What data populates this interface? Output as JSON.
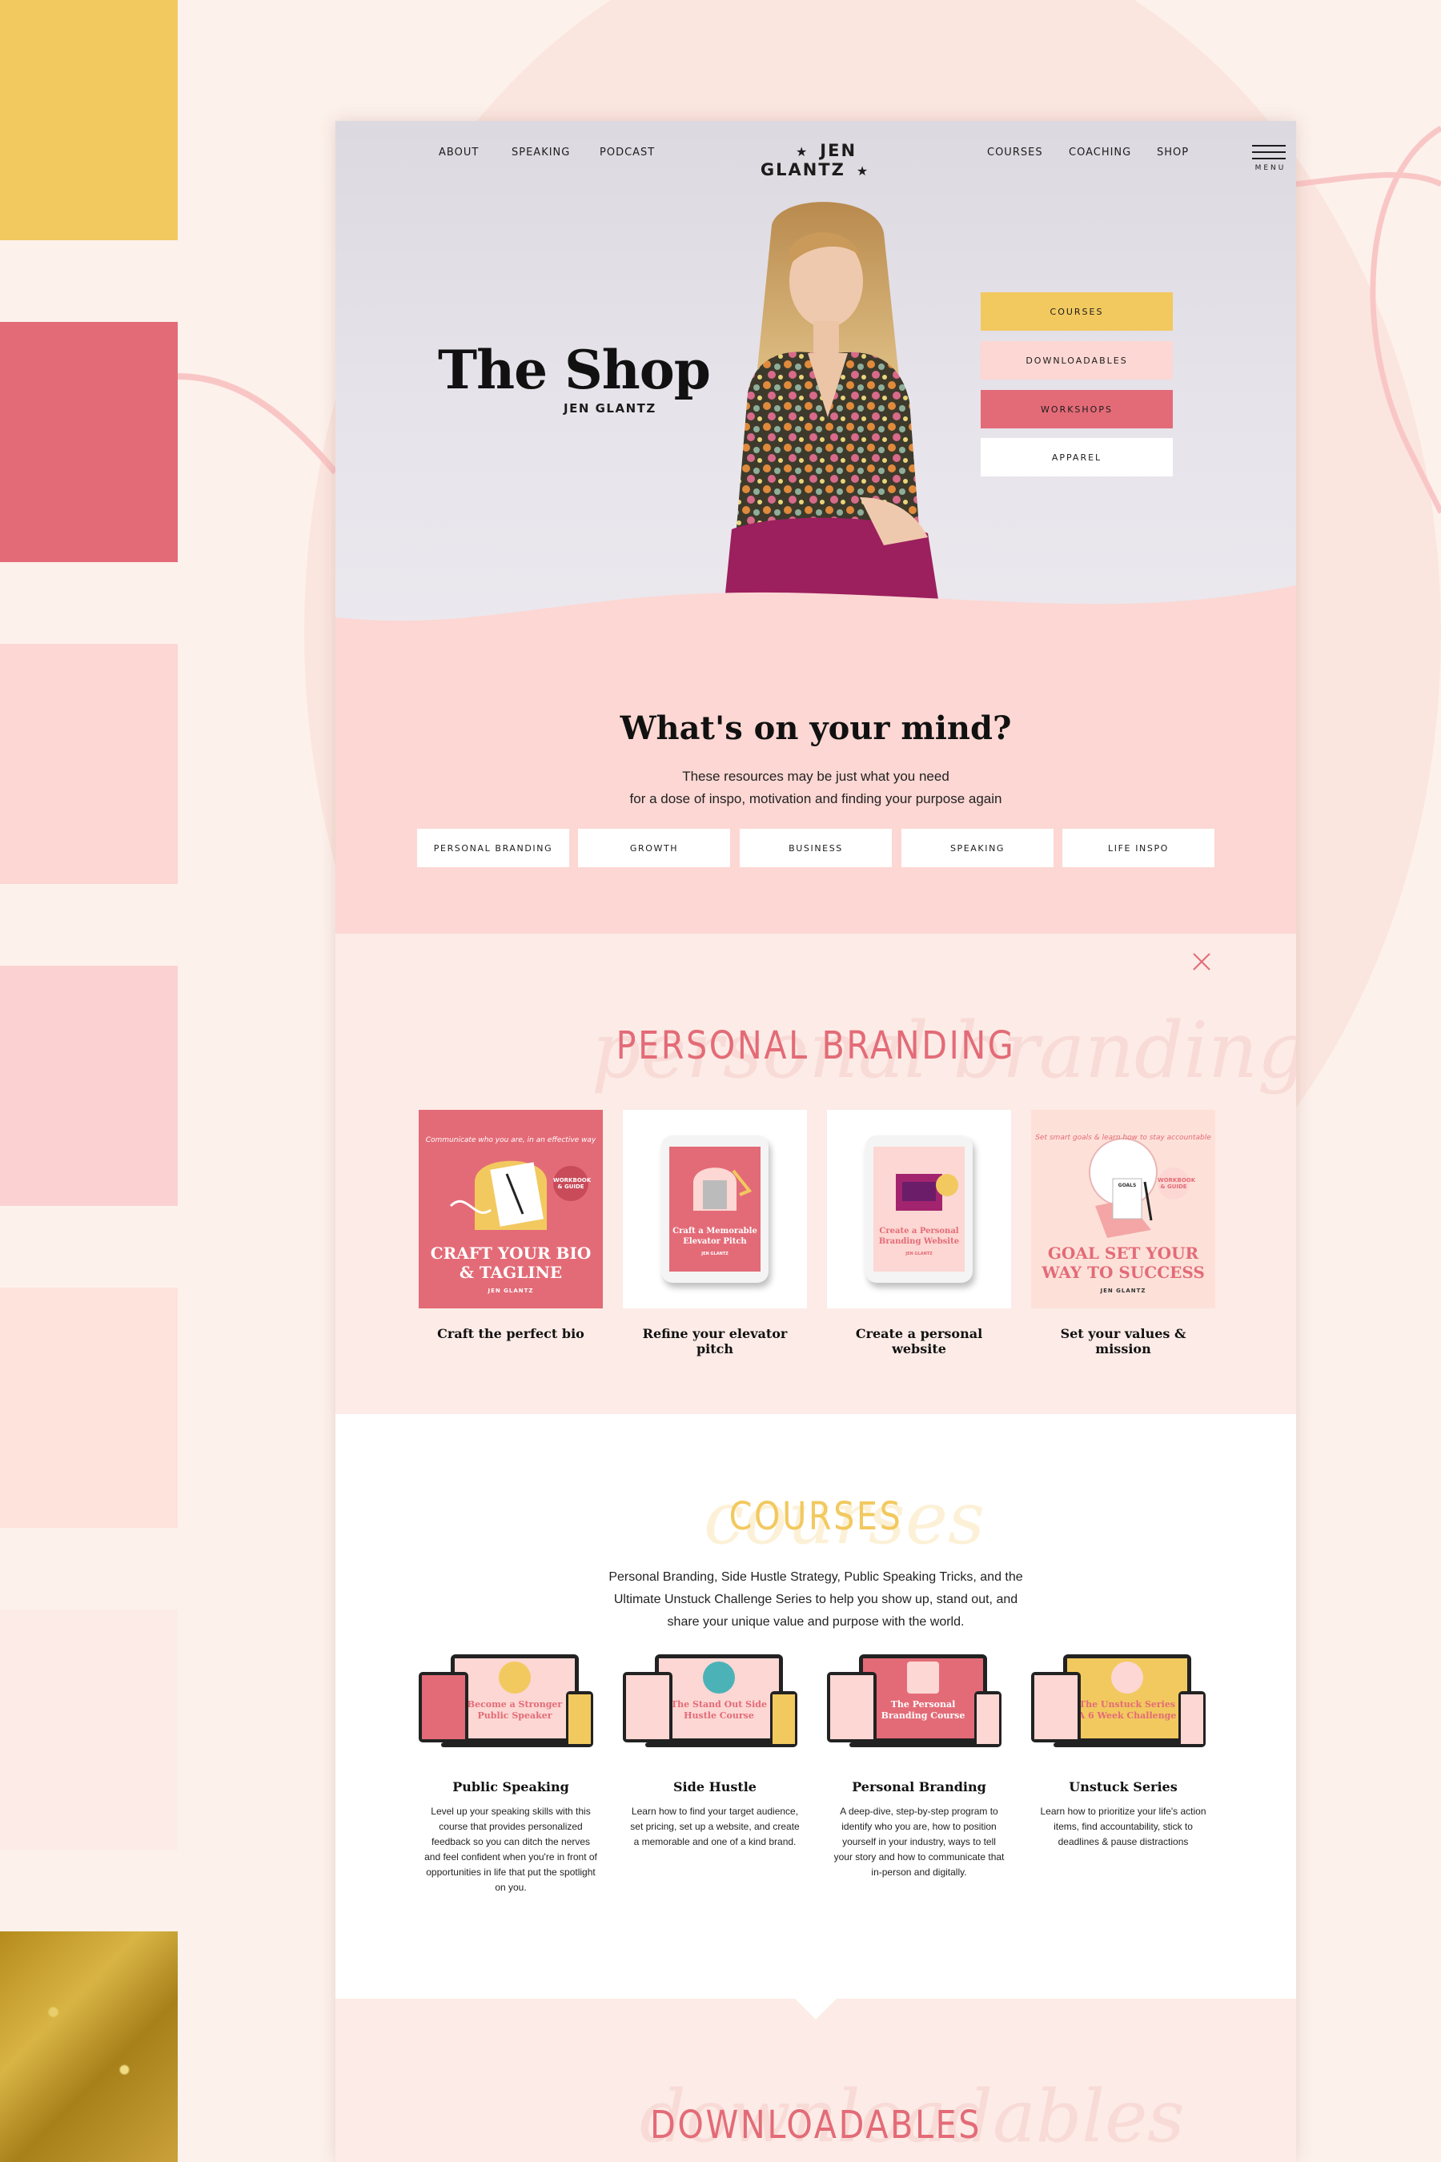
{
  "colors": {
    "yellow": "#f2c95f",
    "coral": "#e36b77",
    "blush": "#fcd7d3",
    "cream": "#fcebe6"
  },
  "nav": {
    "left": [
      "ABOUT",
      "SPEAKING",
      "PODCAST"
    ],
    "brand": "JEN GLANTZ",
    "right": [
      "COURSES",
      "COACHING",
      "SHOP"
    ],
    "menu_label": "MENU"
  },
  "hero": {
    "title": "The Shop",
    "subtitle": "JEN GLANTZ",
    "buttons": [
      "COURSES",
      "DOWNLOADABLES",
      "WORKSHOPS",
      "APPAREL"
    ]
  },
  "mind": {
    "title": "What's on your mind?",
    "text_line1": "These resources may be just what you need",
    "text_line2": "for a dose of inspo, motivation and finding your purpose again",
    "topics": [
      "PERSONAL BRANDING",
      "GROWTH",
      "BUSINESS",
      "SPEAKING",
      "LIFE INSPO"
    ]
  },
  "personal_branding": {
    "title": "PERSONAL BRANDING",
    "script": "personal branding",
    "products": [
      {
        "name": "Craft the perfect bio",
        "cover_line1": "CRAFT YOUR BIO",
        "cover_line2": "& TAGLINE",
        "badge": "WORKBOOK & GUIDE",
        "brand": "JEN GLANTZ",
        "arc_text": "Communicate who you are, in an effective way"
      },
      {
        "name": "Refine your elevator pitch",
        "cover_line1": "Craft a Memorable",
        "cover_line2": "Elevator Pitch",
        "brand": "JEN GLANTZ"
      },
      {
        "name": "Create a personal website",
        "cover_line1": "Create a Personal",
        "cover_line2": "Branding Website",
        "brand": "JEN GLANTZ"
      },
      {
        "name": "Set your values & mission",
        "cover_line1": "GOAL SET YOUR",
        "cover_line2": "WAY TO SUCCESS",
        "badge": "WORKBOOK & GUIDE",
        "brand": "JEN GLANTZ",
        "arc_text": "Set smart goals & learn how to stay accountable",
        "note_label": "GOALS"
      }
    ]
  },
  "courses": {
    "title": "COURSES",
    "script": "courses",
    "text_line1": "Personal Branding, Side Hustle Strategy, Public Speaking Tricks, and the",
    "text_line2": "Ultimate Unstuck Challenge Series to help you show up, stand out, and",
    "text_line3": "share your unique value and purpose with the world.",
    "items": [
      {
        "name": "Public Speaking",
        "screen_line1": "Become a Stronger",
        "screen_line2": "Public Speaker",
        "desc": "Level up your speaking skills with this course that provides personalized feedback so you can ditch the nerves and feel confident when you're in front of opportunities in life that put the spotlight on you."
      },
      {
        "name": "Side Hustle",
        "screen_line1": "The Stand Out Side",
        "screen_line2": "Hustle Course",
        "desc": "Learn how to find your target audience, set pricing, set up a website, and create a memorable and one of a kind brand."
      },
      {
        "name": "Personal Branding",
        "screen_line1": "The Personal",
        "screen_line2": "Branding Course",
        "desc": "A deep-dive, step-by-step program to identify who you are, how to position yourself in your industry, ways to tell your story and how to communicate that in-person and digitally."
      },
      {
        "name": "Unstuck Series",
        "screen_line1": "The Unstuck Series",
        "screen_line2": "A 6 Week Challenge",
        "desc": "Learn how to prioritize your life's action items, find accountability, stick to deadlines & pause distractions"
      }
    ]
  },
  "downloads": {
    "title": "DOWNLOADABLES",
    "script": "downloadables"
  }
}
